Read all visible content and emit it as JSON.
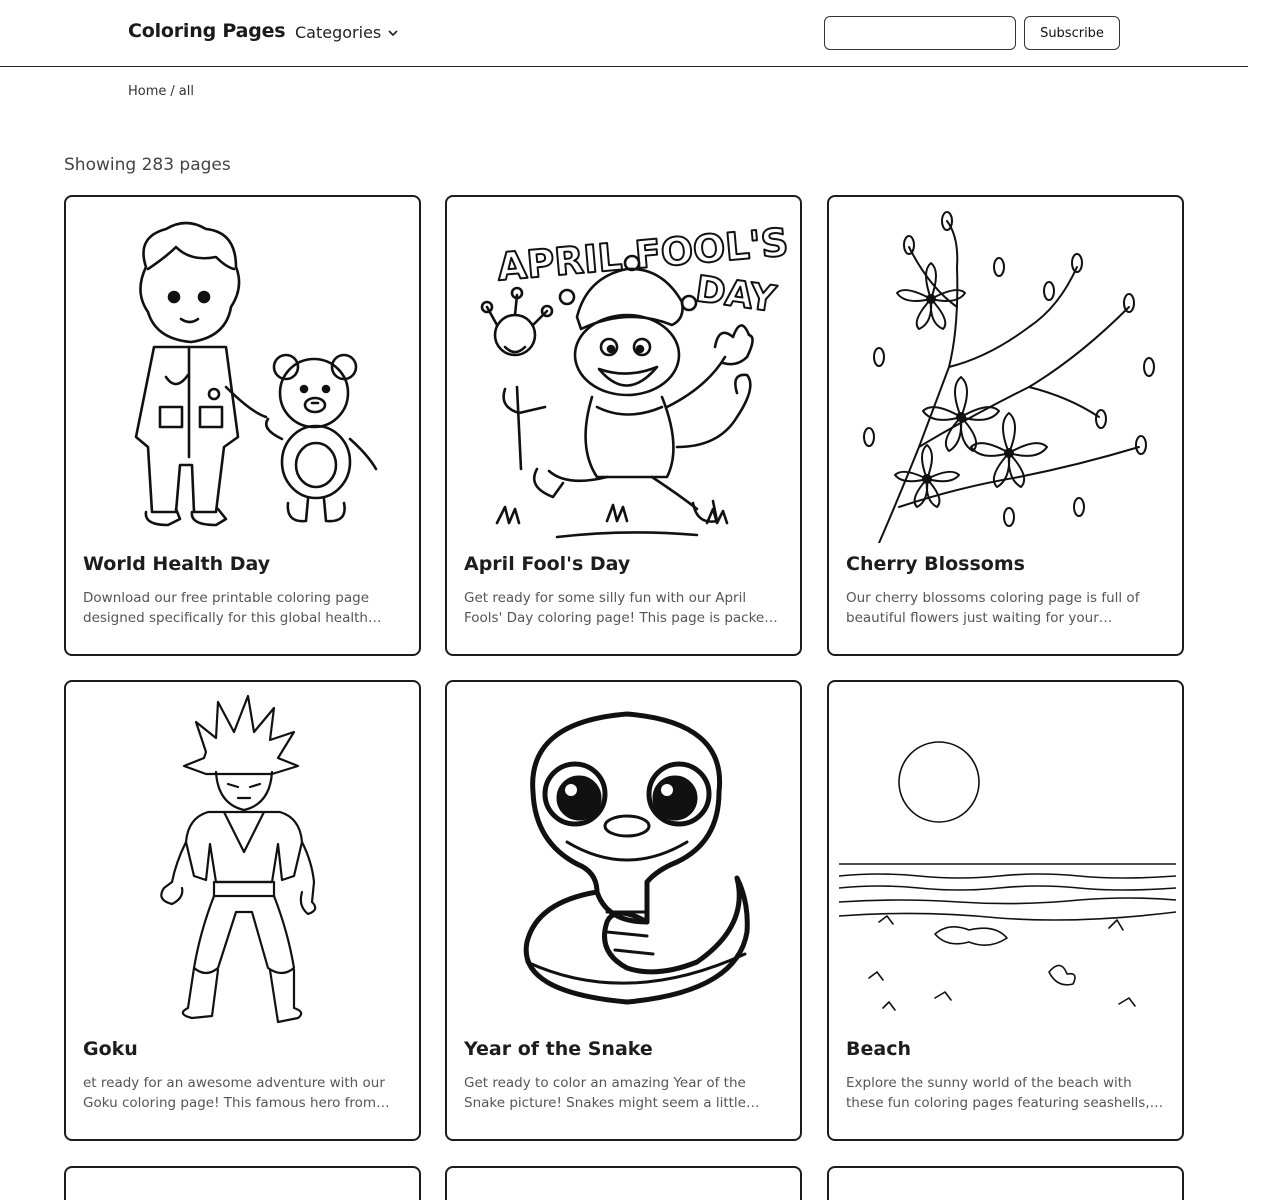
{
  "header": {
    "brand": "Coloring Pages",
    "categories_label": "Categories",
    "search_value": "",
    "subscribe_label": "Subscribe"
  },
  "breadcrumb": {
    "home": "Home",
    "separator": "/",
    "current": "all"
  },
  "listing": {
    "count_text": "Showing 283 pages"
  },
  "cards": [
    {
      "title": "World Health Day",
      "description": "Download our free printable coloring page designed specifically for this global health…",
      "image": "doctor-boy-with-teddy-bear"
    },
    {
      "title": "April Fool's Day",
      "description": "Get ready for some silly fun with our April Fools' Day coloring page! This page is packed with laug…",
      "image": "jester-monkey",
      "image_text_line1": "APRIL FOOL'S",
      "image_text_line2": "DAY"
    },
    {
      "title": "Cherry Blossoms",
      "description": "Our cherry blossoms coloring page is full of beautiful flowers just waiting for your creative…",
      "image": "cherry-blossom-branch"
    },
    {
      "title": "Goku",
      "description": "et ready for an awesome adventure with our Goku coloring page! This famous hero from Dragon Ba…",
      "image": "goku-standing"
    },
    {
      "title": "Year of the Snake",
      "description": "Get ready to color an amazing Year of the Snake picture! Snakes might seem a little scary, but in…",
      "image": "cartoon-snake"
    },
    {
      "title": "Beach",
      "description": "Explore the sunny world of the beach with these fun coloring pages featuring seashells,…",
      "image": "beach-scene"
    }
  ]
}
